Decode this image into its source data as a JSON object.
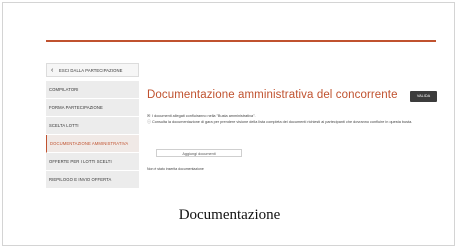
{
  "sidebar": {
    "back_label": "ESCI DALLA PARTECIPAZIONE",
    "items": [
      {
        "label": "COMPILATORI"
      },
      {
        "label": "FORMA PARTECIPAZIONE"
      },
      {
        "label": "SCELTA LOTTI"
      },
      {
        "label": "DOCUMENTAZIONE AMMINISTRATIVA",
        "active": true
      },
      {
        "label": "OFFERTE PER I LOTTI SCELTI"
      },
      {
        "label": "RIEPILOGO E INVIO OFFERTA"
      }
    ]
  },
  "main": {
    "title": "Documentazione amministrativa del concorrente",
    "valida_label": "VALIDA",
    "info_line1": "I documenti allegati confluiranno nella \"Busta amministrativa\".",
    "info_line2": "Consulta la documentazione di gara per prendere visione della lista completa dei documenti richiesti ai partecipanti che dovranno confluire in questa busta.",
    "add_button": "Aggiungi documenti",
    "empty_text": "Non è stato inserita documentazione"
  },
  "caption": "Documentazione",
  "colors": {
    "accent": "#c0522f",
    "sidebar_bg": "#ececec"
  },
  "icons": {
    "back": "chevron-left-icon",
    "envelope": "envelope-icon",
    "info": "info-icon"
  }
}
